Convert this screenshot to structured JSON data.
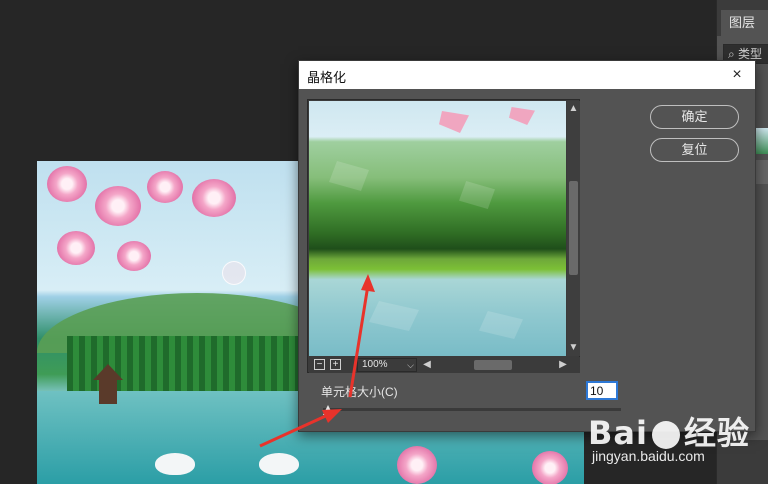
{
  "app": {
    "accent": "#2d78d6",
    "workspace_bg": "#262626",
    "panel_bg": "#535353"
  },
  "layers_panel": {
    "tab_label": "图层",
    "search_label": "⌕ 类型"
  },
  "dialog": {
    "title": "晶格化",
    "close_icon": "×",
    "buttons": {
      "ok": "确定",
      "reset": "复位"
    },
    "zoom": {
      "value": "100%",
      "zoom_out": "−",
      "zoom_in": "+"
    },
    "cell_size": {
      "label": "单元格大小(C)",
      "value": "10",
      "slider_fraction": 0.0
    }
  },
  "watermark": {
    "logo": "Bai 经验",
    "url": "jingyan.baidu.com"
  }
}
